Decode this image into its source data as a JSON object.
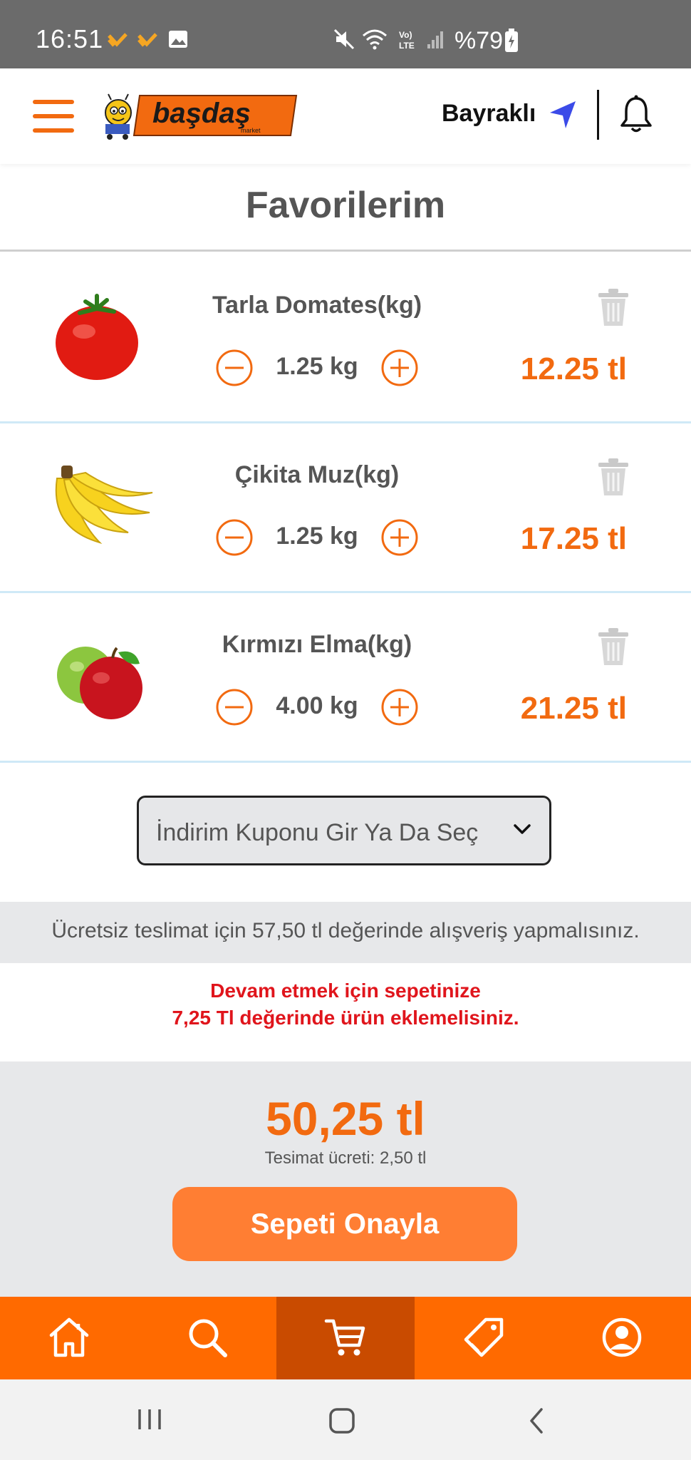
{
  "status_bar": {
    "time": "16:51",
    "right_text": "%79",
    "icons": [
      "app-notification-icon",
      "app-notification-icon",
      "gallery-icon",
      "mute-icon",
      "wifi-icon",
      "volte-icon",
      "signal-icon",
      "battery-charging-icon"
    ]
  },
  "header": {
    "location": "Bayraklı",
    "logo_text": "başdaş",
    "logo_subtext": "market"
  },
  "page": {
    "title": "Favorilerim"
  },
  "products": [
    {
      "name": "Tarla Domates(kg)",
      "qty": "1.25 kg",
      "price": "12.25 tl",
      "image": "tomato"
    },
    {
      "name": "Çikita Muz(kg)",
      "qty": "1.25 kg",
      "price": "17.25 tl",
      "image": "banana"
    },
    {
      "name": "Kırmızı Elma(kg)",
      "qty": "4.00 kg",
      "price": "21.25 tl",
      "image": "apple"
    }
  ],
  "coupon": {
    "label": "İndirim Kuponu Gir Ya Da Seç"
  },
  "delivery_notice": "Ücretsiz teslimat için 57,50 tl değerinde alışveriş yapmalısınız.",
  "warning": {
    "line1": "Devam etmek için sepetinize",
    "line2": "7,25 Tl değerinde ürün eklemelisiniz."
  },
  "checkout": {
    "total": "50,25 tl",
    "fee": "Tesimat ücreti: 2,50 tl",
    "confirm_label": "Sepeti Onayla"
  },
  "bottom_nav": [
    {
      "icon": "home-icon",
      "active": false
    },
    {
      "icon": "search-icon",
      "active": false
    },
    {
      "icon": "cart-icon",
      "active": true
    },
    {
      "icon": "tag-icon",
      "active": false
    },
    {
      "icon": "profile-icon",
      "active": false
    }
  ],
  "colors": {
    "accent": "#f26a10",
    "nav": "#ff6a00",
    "nav_active": "#c94b00",
    "warning": "#e0151c"
  }
}
